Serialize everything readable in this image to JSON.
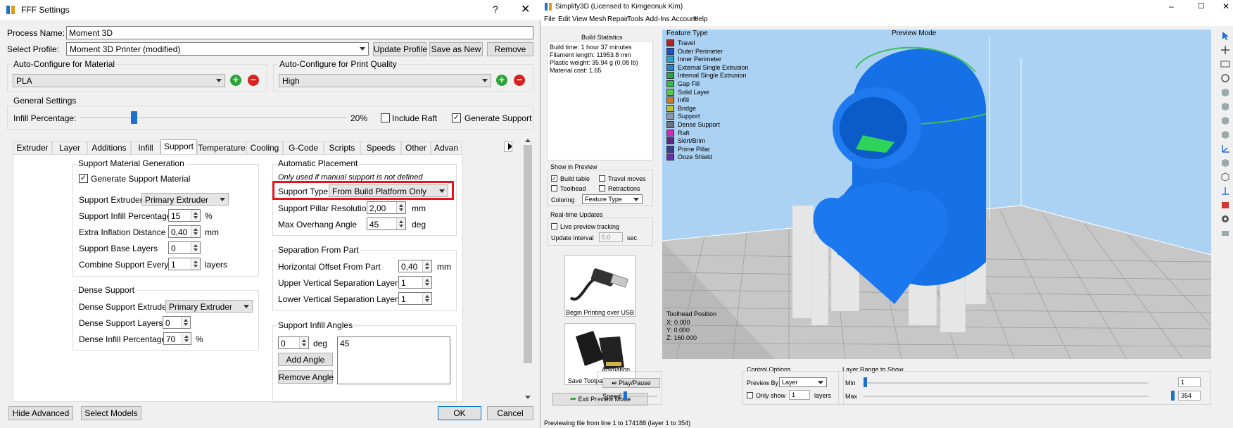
{
  "fff": {
    "title": "FFF Settings",
    "help": "?",
    "close": "✕",
    "process_name_label": "Process Name:",
    "process_name_value": "Moment 3D",
    "select_profile_label": "Select Profile:",
    "select_profile_value": "Moment 3D Printer (modified)",
    "update_profile": "Update Profile",
    "save_as_new": "Save as New",
    "remove": "Remove",
    "auto_material_title": "Auto-Configure for Material",
    "material_value": "PLA",
    "auto_quality_title": "Auto-Configure for Print Quality",
    "quality_value": "High",
    "general_title": "General Settings",
    "infill_label": "Infill Percentage:",
    "infill_value": "20%",
    "infill_fraction": 0.2,
    "include_raft": "Include Raft",
    "generate_support": "Generate Support",
    "tabs": [
      "Extruder",
      "Layer",
      "Additions",
      "Infill",
      "Support",
      "Temperature",
      "Cooling",
      "G-Code",
      "Scripts",
      "Speeds",
      "Other",
      "Advan"
    ],
    "support_gen": {
      "title": "Support Material Generation",
      "generate_label": "Generate Support Material",
      "extruder_label": "Support Extruder",
      "extruder_value": "Primary Extruder",
      "infill_pct_label": "Support Infill Percentage",
      "infill_pct_value": "15",
      "pct_unit": "%",
      "inflation_label": "Extra Inflation Distance",
      "inflation_value": "0,40",
      "mm_unit": "mm",
      "base_layers_label": "Support Base Layers",
      "base_layers_value": "0",
      "combine_label": "Combine Support Every",
      "combine_value": "1",
      "layers_unit": "layers"
    },
    "dense": {
      "title": "Dense Support",
      "extruder_label": "Dense Support Extruder",
      "extruder_value": "Primary Extruder",
      "layers_label": "Dense Support Layers",
      "layers_value": "0",
      "infill_label": "Dense Infill Percentage",
      "infill_value": "70",
      "pct_unit": "%"
    },
    "auto_place": {
      "title": "Automatic Placement",
      "note": "Only used if manual support is not defined",
      "type_label": "Support Type",
      "type_value": "From Build Platform Only",
      "pillar_label": "Support Pillar Resolution",
      "pillar_value": "2,00",
      "mm_unit": "mm",
      "overhang_label": "Max Overhang Angle",
      "overhang_value": "45",
      "deg_unit": "deg"
    },
    "separation": {
      "title": "Separation From Part",
      "horiz_label": "Horizontal Offset From Part",
      "horiz_value": "0,40",
      "mm_unit": "mm",
      "upper_label": "Upper Vertical Separation Layers",
      "upper_value": "1",
      "lower_label": "Lower Vertical Separation Layers",
      "lower_value": "1"
    },
    "angles": {
      "title": "Support Infill Angles",
      "angle_value": "0",
      "deg_unit": "deg",
      "add": "Add Angle",
      "remove": "Remove Angle",
      "list_value": "45"
    },
    "hide_advanced": "Hide Advanced",
    "select_models": "Select Models",
    "ok": "OK",
    "cancel": "Cancel",
    "highlight_color": "#e8131b"
  },
  "s3d": {
    "title": "Simplify3D (Licensed to Kimgeonuk Kim)",
    "menu": [
      "File",
      "Edit",
      "View",
      "Mesh",
      "Repair",
      "Tools",
      "Add-Ins",
      "Account",
      "Help"
    ],
    "build_stats_title": "Build Statistics",
    "build_stats": [
      "Build time: 1 hour 37 minutes",
      "Filament length: 11953.8 mm",
      "Plastic weight: 35.94 g (0.08 lb)",
      "Material cost: 1.65"
    ],
    "show_title": "Show in Preview",
    "build_table": "Build table",
    "travel_moves": "Travel moves",
    "toolhead": "Toolhead",
    "retractions": "Retractions",
    "coloring_label": "Coloring",
    "coloring_value": "Feature Type",
    "rt_title": "Real-time Updates",
    "live_preview": "Live preview tracking",
    "update_interval": "Update interval",
    "update_value": "5.0",
    "sec": "sec",
    "usb_label": "Begin Printing over USB",
    "sd_label": "Save Toolpaths to Disk",
    "exit_preview": "Exit Preview Mode",
    "feature_type_title": "Feature Type",
    "preview_mode": "Preview Mode",
    "legend": [
      {
        "name": "Travel",
        "color": "#b52424"
      },
      {
        "name": "Outer Perimeter",
        "color": "#1f4fd6"
      },
      {
        "name": "Inner Perimeter",
        "color": "#27a1c9"
      },
      {
        "name": "External Single Extrusion",
        "color": "#2b7fc9"
      },
      {
        "name": "Internal Single Extrusion",
        "color": "#2aa149"
      },
      {
        "name": "Gap Fill",
        "color": "#38b847"
      },
      {
        "name": "Solid Layer",
        "color": "#60c34c"
      },
      {
        "name": "Infill",
        "color": "#c97b28"
      },
      {
        "name": "Bridge",
        "color": "#b4c432"
      },
      {
        "name": "Support",
        "color": "#8f96a3"
      },
      {
        "name": "Dense Support",
        "color": "#6d747e"
      },
      {
        "name": "Raft",
        "color": "#cf2bb8"
      },
      {
        "name": "Skirt/Brim",
        "color": "#5a2a80"
      },
      {
        "name": "Prime Pillar",
        "color": "#3b3d8f"
      },
      {
        "name": "Ooze Shield",
        "color": "#6a2fb0"
      }
    ],
    "toolhead_pos_title": "Toolhead Position",
    "pos_x": "X: 0.000",
    "pos_y": "Y: 0.000",
    "pos_z": "Z: 160.000",
    "animation_title": "Animation",
    "play_pause": "Play/Pause",
    "speed_label": "Speed:",
    "control_title": "Control Options",
    "preview_by_label": "Preview By",
    "preview_by_value": "Layer",
    "only_show": "Only show",
    "only_value": "1",
    "layers": "layers",
    "range_title": "Layer Range to Show",
    "min_label": "Min",
    "max_label": "Max",
    "min_value": "1",
    "max_value": "354",
    "status": "Previewing file from line 1 to 174188 (layer 1 to 354)"
  }
}
